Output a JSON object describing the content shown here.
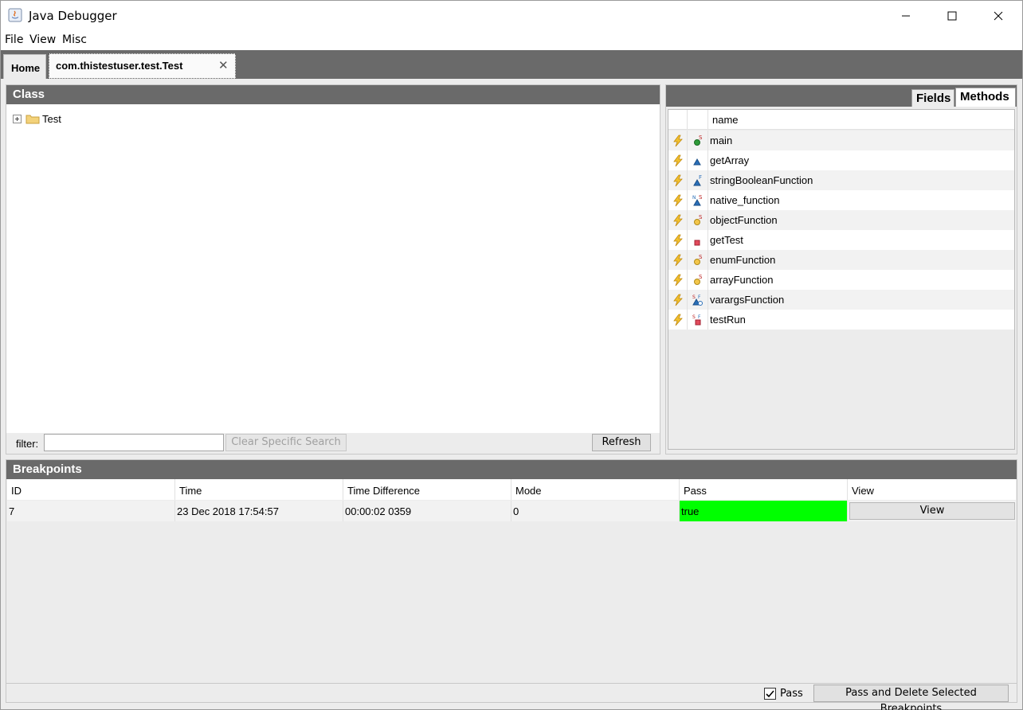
{
  "window": {
    "title": "Java Debugger",
    "icon": "java-app-icon",
    "controls": [
      "minimize",
      "maximize",
      "close"
    ]
  },
  "menu": [
    "File",
    "View",
    "Misc"
  ],
  "tabs": {
    "home": "Home",
    "active": "com.thistestuser.test.Test"
  },
  "class_panel": {
    "title": "Class",
    "tree": [
      {
        "label": "Test",
        "icon": "folder-icon"
      }
    ],
    "filter_label": "filter:",
    "filter_value": "",
    "clear_button": "Clear Specific Search",
    "refresh_button": "Refresh"
  },
  "methods_panel": {
    "tabs": [
      "Fields",
      "Methods"
    ],
    "selected_tab": "Methods",
    "column_header": "name",
    "methods": [
      {
        "name": "main",
        "icon": "public-static-method-icon"
      },
      {
        "name": "getArray",
        "icon": "default-method-icon"
      },
      {
        "name": "stringBooleanFunction",
        "icon": "default-final-method-icon"
      },
      {
        "name": "native_function",
        "icon": "default-native-static-method-icon"
      },
      {
        "name": "objectFunction",
        "icon": "protected-static-method-icon"
      },
      {
        "name": "getTest",
        "icon": "private-method-icon"
      },
      {
        "name": "enumFunction",
        "icon": "protected-static-method-icon"
      },
      {
        "name": "arrayFunction",
        "icon": "protected-static-method-icon"
      },
      {
        "name": "varargsFunction",
        "icon": "default-static-final-synchronized-method-icon"
      },
      {
        "name": "testRun",
        "icon": "private-static-final-method-icon"
      }
    ]
  },
  "breakpoints": {
    "title": "Breakpoints",
    "columns": [
      "ID",
      "Time",
      "Time Difference",
      "Mode",
      "Pass",
      "View"
    ],
    "rows": [
      {
        "id": "7",
        "time": "23 Dec 2018 17:54:57",
        "time_difference": "00:00:02 0359",
        "mode": "0",
        "pass": "true",
        "view": "View"
      }
    ],
    "pass_checkbox_label": "Pass",
    "pass_checked": true,
    "delete_button": "Pass and Delete Selected Breakpoints"
  },
  "colors": {
    "header_gray": "#6a6a6a",
    "pass_true": "#00ff00",
    "background": "#ececec"
  }
}
